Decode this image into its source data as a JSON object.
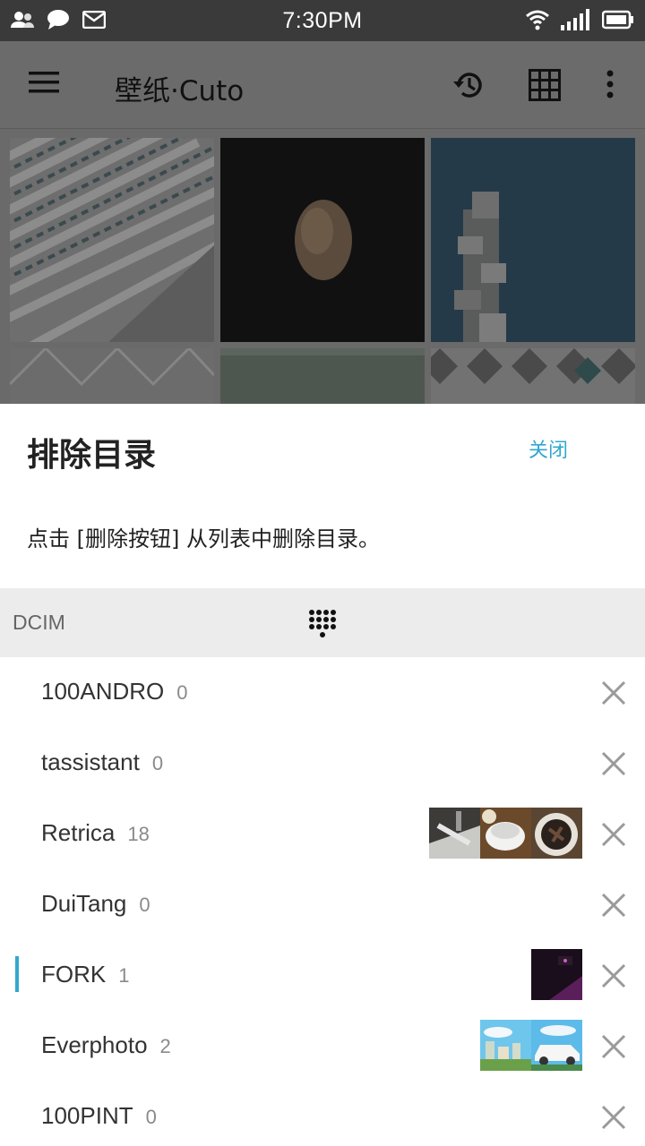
{
  "status_bar": {
    "time": "7:30PM"
  },
  "toolbar": {
    "title": "壁纸·Cuto"
  },
  "sheet": {
    "title": "排除目录",
    "close_label": "关闭",
    "description": "点击 [删除按钮] 从列表中删除目录。"
  },
  "section": {
    "label": "DCIM"
  },
  "folders": [
    {
      "name": "100ANDRO",
      "count": "0",
      "previews": []
    },
    {
      "name": "tassistant",
      "count": "0",
      "previews": []
    },
    {
      "name": "Retrica",
      "count": "18",
      "previews": [
        "photo-kitchen",
        "photo-coffee-cup",
        "photo-cake"
      ]
    },
    {
      "name": "DuiTang",
      "count": "0",
      "previews": []
    },
    {
      "name": "FORK",
      "count": "1",
      "selected": true,
      "previews": [
        "photo-dark-room"
      ]
    },
    {
      "name": "Everphoto",
      "count": "2",
      "previews": [
        "photo-city",
        "photo-car"
      ]
    },
    {
      "name": "100PINT",
      "count": "0",
      "previews": []
    }
  ],
  "colors": {
    "accent": "#33a7cf",
    "status_bar": "#3a3a3a",
    "section_bg": "#ececec"
  }
}
